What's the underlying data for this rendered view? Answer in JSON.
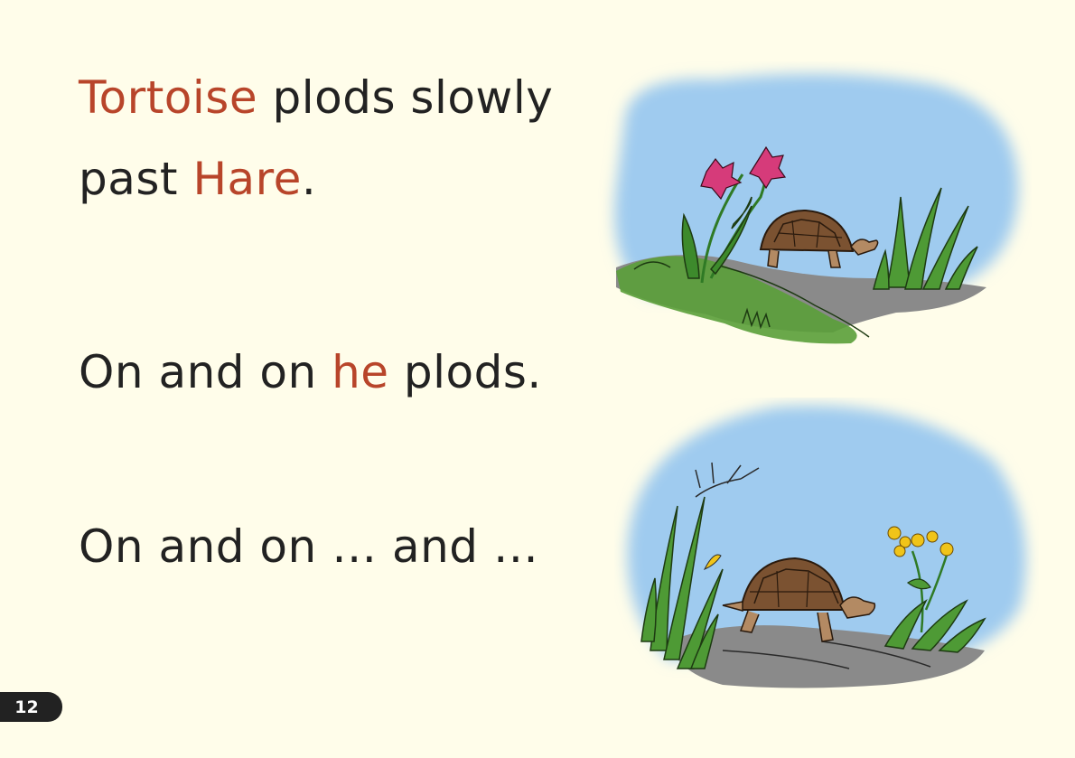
{
  "text": {
    "line1": {
      "highlight": "Tortoise",
      "rest": " plods slowly"
    },
    "line2": {
      "plain": "past ",
      "highlight": "Hare",
      "end": "."
    },
    "line3": {
      "plain": "On and on ",
      "highlight": "he",
      "end": " plods."
    },
    "line4": {
      "plain": "On and on … and …"
    }
  },
  "page_number": "12",
  "colors": {
    "background": "#fffdea",
    "text": "#222222",
    "highlight": "#b8452a",
    "sky": "#9fcbef"
  },
  "illustrations": {
    "top": {
      "icon": "tortoise-with-flowers-illustration"
    },
    "bottom": {
      "icon": "tortoise-walking-illustration"
    }
  }
}
